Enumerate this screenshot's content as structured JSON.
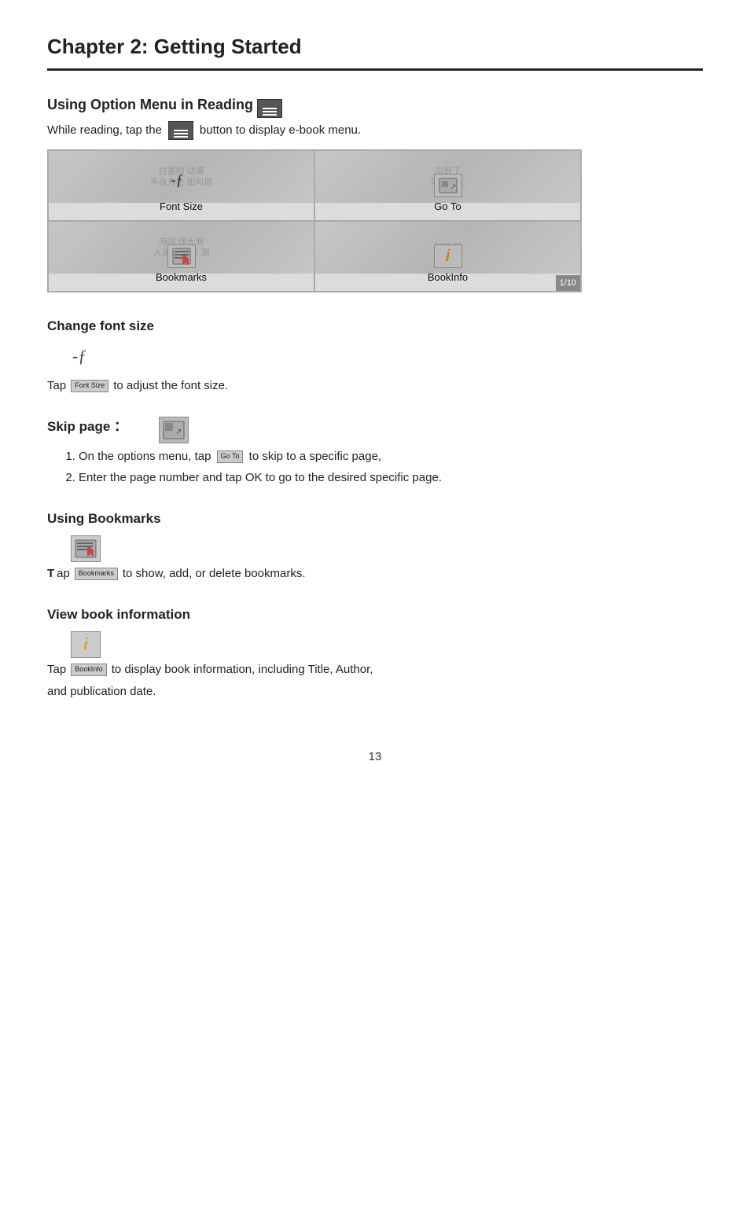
{
  "chapter": {
    "title": "Chapter 2: Getting Started"
  },
  "section_using_option": {
    "title": "Using Option Menu in Reading",
    "intro_prefix": "While reading, tap the",
    "intro_suffix": "button to display e-book menu."
  },
  "menu_grid": {
    "cell1": {
      "label": "Font Size",
      "bg_text": "白富帅 动漫 半夜方止 如何屌"
    },
    "cell2": {
      "label": "Go To",
      "bg_text": "叫到了 如何屌无"
    },
    "cell3": {
      "label": "Bookmarks",
      "bg_text": "海阔 伐大浪 入海中 年轻 潮"
    },
    "cell4": {
      "label": "BookInfo",
      "bg_text": ""
    },
    "page_badge": "1/10"
  },
  "section_font": {
    "heading": "Change font size",
    "tap_prefix": "Tap",
    "font_size_label": "Font Size",
    "tap_suffix": "to adjust the font size."
  },
  "section_skip": {
    "heading": "Skip page ：",
    "step1_prefix": "On the options menu, tap",
    "goto_label": "Go To",
    "step1_suffix": "to skip to a specific page,",
    "step2": "Enter the page number and tap OK to go to the desired specific page."
  },
  "section_bookmarks": {
    "heading": "Using Bookmarks",
    "tap_prefix": "Tap",
    "bookmarks_label": "Bookmarks",
    "tap_suffix": "to show, add, or delete bookmarks."
  },
  "section_bookinfo": {
    "heading": "View book information",
    "tap_prefix": "Tap",
    "bookinfo_label": "BookInfo",
    "tap_suffix": "to display book information, including Title, Author,"
  },
  "continuation": "and publication date.",
  "page_number": "13"
}
